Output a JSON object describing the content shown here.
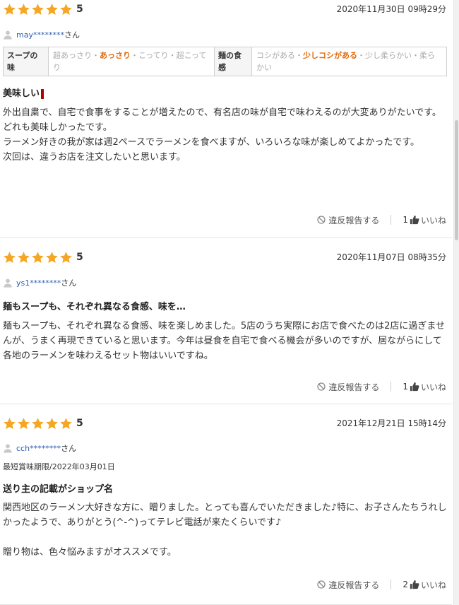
{
  "colors": {
    "star": "#f5a623",
    "user_link": "#2a5db0",
    "selected": "#e06a0a"
  },
  "icons": {
    "star": "star-icon",
    "user": "user-icon",
    "report": "ban-icon",
    "like": "thumbs-up-icon"
  },
  "reviews": [
    {
      "score": "5",
      "rating": 5,
      "date": "2020年11月30日 09時29分",
      "user": "may********",
      "san": "さん",
      "attributes": {
        "soup_label": "スープの味",
        "soup_options": {
          "a": "超あっさり・",
          "sel": "あっさり",
          "b": "・こってり・超こってり"
        },
        "noodle_label": "麺の食感",
        "noodle_options": {
          "a": "コシがある・",
          "sel": "少しコシがある",
          "b": "・少し柔らかい・柔らかい"
        }
      },
      "title": "美味しい",
      "body": [
        "外出自粛で、自宅で食事をすることが増えたので、有名店の味が自宅で味わえるのが大変ありがたいです。",
        "どれも美味しかったです。",
        "ラーメン好きの我が家は週2ペースでラーメンを食べますが、いろいろな味が楽しめてよかったです。",
        "次回は、違うお店を注文したいと思います。"
      ],
      "report": "違反報告する",
      "likes": "1",
      "like_label": "いいね"
    },
    {
      "score": "5",
      "rating": 5,
      "date": "2020年11月07日 08時35分",
      "user": "ys1********",
      "san": "さん",
      "title": "麺もスープも、それぞれ異なる食感、味を…",
      "body": [
        "麺もスープも、それぞれ異なる食感、味を楽しめました。5店のうち実際にお店で食べたのは2店に過ぎませんが、うまく再現できていると思います。今年は昼食を自宅で食べる機会が多いのですが、居ながらにして各地のラーメンを味わえるセット物はいいですね。"
      ],
      "report": "違反報告する",
      "likes": "1",
      "like_label": "いいね"
    },
    {
      "score": "5",
      "rating": 5,
      "date": "2021年12月21日 15時14分",
      "user": "cch********",
      "san": "さん",
      "expiry": "最短賞味期限/2022年03月01日",
      "title": "送り主の記載がショップ名",
      "body": [
        "関西地区のラーメン大好きな方に、贈りました。とっても喜んでいただきました♪特に、お子さんたちうれしかったようで、ありがとう(^-^)ってテレビ電話が来たくらいです♪",
        "",
        "贈り物は、色々悩みますがオススメです。"
      ],
      "report": "違反報告する",
      "likes": "2",
      "like_label": "いいね"
    }
  ]
}
